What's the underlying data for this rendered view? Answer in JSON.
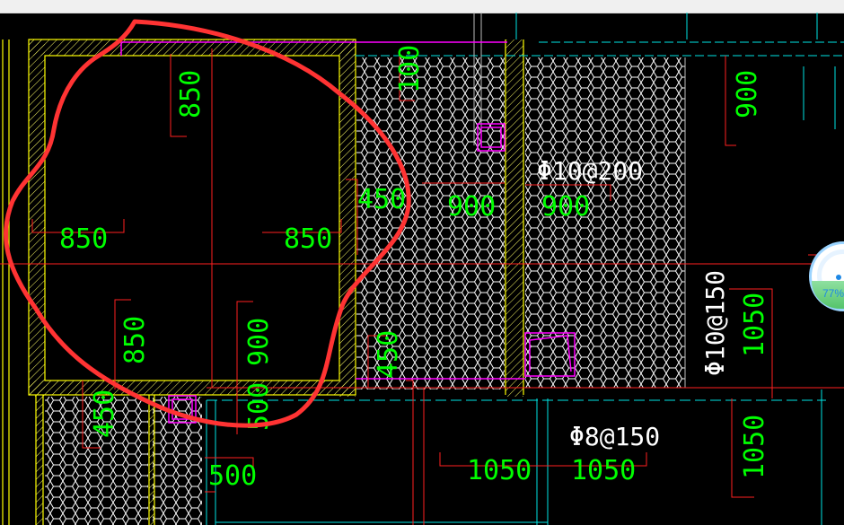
{
  "dimensions": {
    "d850_top": "850",
    "d850_left": "850",
    "d850_right": "850",
    "d850_bottom": "850",
    "d900_bottom": "900",
    "d450_mid": "450",
    "d900_a": "900",
    "d900_b": "900",
    "d900_right": "900",
    "d450_lower": "450",
    "d450_left": "450",
    "d500": "500",
    "d500_b": "500",
    "d1050_a": "1050",
    "d1050_b": "1050",
    "d1050_right": "1050",
    "d1050_right2": "1050",
    "d100_top": "100"
  },
  "rebar": {
    "top": "Φ10@200",
    "vertical": "Φ10@150",
    "bottom": "Φ8@150"
  },
  "widget": {
    "percent": "77%",
    "percent_value": 0.77
  },
  "colors": {
    "background": "#000000",
    "dimension_text": "#00ff00",
    "dimension_line": "#ff0000",
    "wall": "#ffff00",
    "outline": "#ff00ff",
    "axis": "#00ffff",
    "annotation": "#ff3333"
  }
}
